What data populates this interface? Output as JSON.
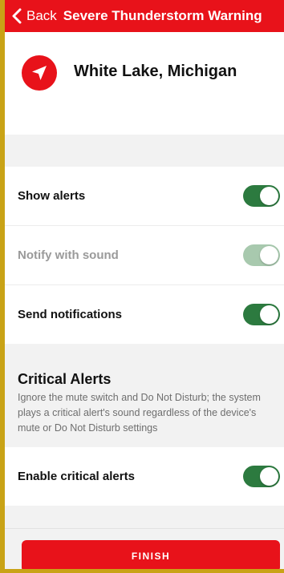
{
  "navbar": {
    "back_label": "Back",
    "title": "Severe Thunderstorm Warning",
    "background_color": "#e8121a"
  },
  "location": {
    "name": "White Lake, Michigan",
    "icon": "location-arrow-icon"
  },
  "settings": [
    {
      "label": "Show alerts",
      "enabled": true,
      "disabled": false
    },
    {
      "label": "Notify with sound",
      "enabled": true,
      "disabled": true
    },
    {
      "label": "Send notifications",
      "enabled": true,
      "disabled": false
    }
  ],
  "critical": {
    "title": "Critical Alerts",
    "description": "Ignore the mute switch and Do Not Disturb; the system plays a critical alert's sound regardless of the device's mute or Do Not Disturb settings",
    "toggle_label": "Enable critical alerts",
    "toggle_enabled": true
  },
  "finish": {
    "label": "FINISH"
  },
  "colors": {
    "accent": "#e8121a",
    "toggle_on": "#2c7a3f",
    "toggle_disabled": "#a8c9ae"
  }
}
